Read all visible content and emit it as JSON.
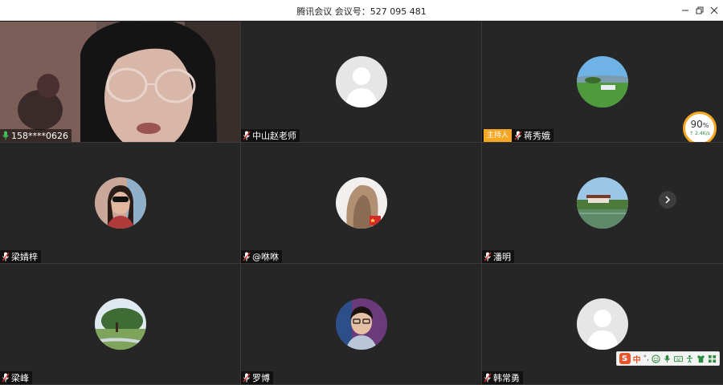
{
  "window": {
    "title": "腾讯会议 会议号：527 095 481"
  },
  "participants": [
    {
      "name": "158****0626",
      "mic": "active"
    },
    {
      "name": "中山赵老师",
      "mic": "muted"
    },
    {
      "name": "蒋秀娥",
      "mic": "muted",
      "host_badge": "主持人"
    },
    {
      "name": "梁婧梓",
      "mic": "muted"
    },
    {
      "name": "@咻咻",
      "mic": "muted"
    },
    {
      "name": "潘明",
      "mic": "muted"
    },
    {
      "name": "梁峰",
      "mic": "muted"
    },
    {
      "name": "罗博",
      "mic": "muted"
    },
    {
      "name": "韩常勇",
      "mic": "muted"
    }
  ],
  "network": {
    "percent": "90",
    "percent_unit": "%",
    "speed": "↑ 2.4K/s"
  },
  "ime": {
    "logo": "S",
    "mode": "中",
    "punct": "°,"
  },
  "colors": {
    "host_badge": "#f5a623",
    "tile_bg": "#262626",
    "ime_brand": "#e8552d"
  }
}
